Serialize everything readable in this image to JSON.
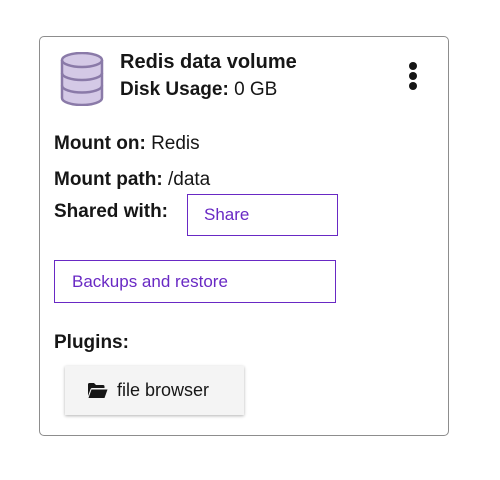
{
  "volume": {
    "title": "Redis data volume",
    "disk_usage_label": "Disk Usage:",
    "disk_usage_value": "0 GB",
    "icon": "database-icon"
  },
  "menu": {
    "icon": "kebab-menu-icon"
  },
  "details": {
    "mount_on_label": "Mount on:",
    "mount_on_value": "Redis",
    "mount_path_label": "Mount path:",
    "mount_path_value": "/data",
    "shared_with_label": "Shared with:"
  },
  "actions": {
    "share_label": "Share",
    "backups_label": "Backups and restore"
  },
  "plugins": {
    "label": "Plugins:",
    "items": [
      {
        "label": "file browser",
        "icon": "folder-open-icon"
      }
    ]
  },
  "colors": {
    "accent": "#6929c4",
    "icon_fill": "#d4c9e6",
    "icon_stroke": "#8a7aa8",
    "text": "#161616",
    "border": "#8d8d8d",
    "plugin_button_bg": "#f4f4f4"
  }
}
